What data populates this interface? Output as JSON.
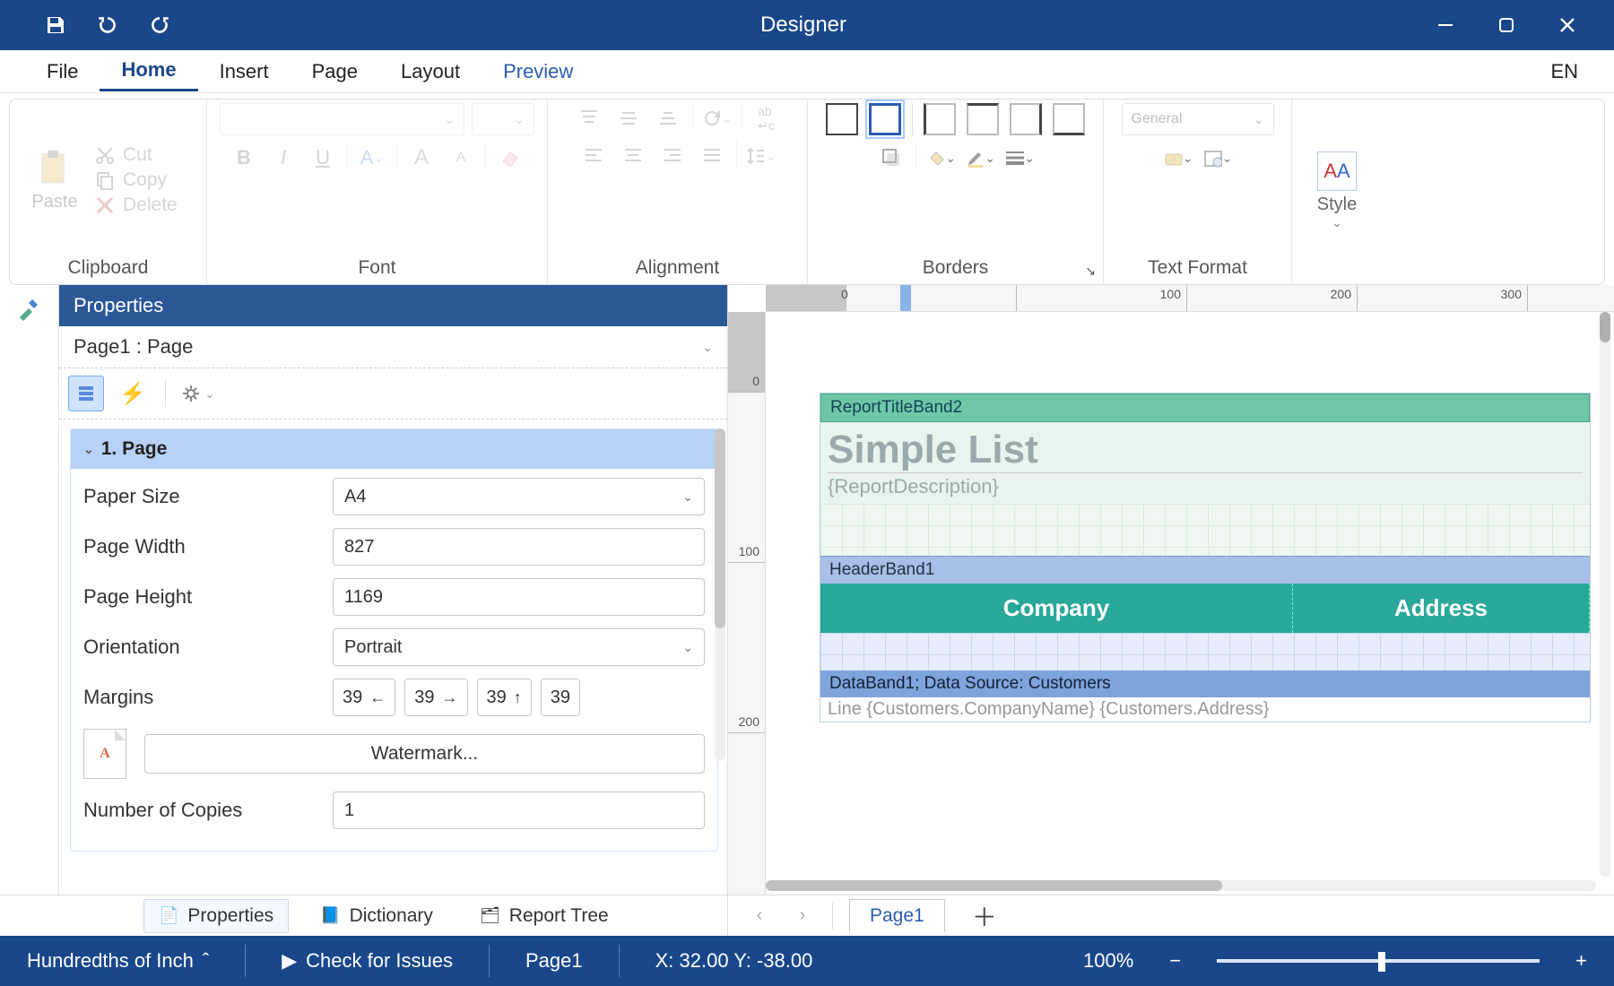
{
  "titlebar": {
    "title": "Designer"
  },
  "menu": {
    "items": [
      "File",
      "Home",
      "Insert",
      "Page",
      "Layout",
      "Preview"
    ],
    "active": "Home",
    "language": "EN"
  },
  "ribbon": {
    "clipboard": {
      "paste": "Paste",
      "cut": "Cut",
      "copy": "Copy",
      "delete": "Delete",
      "label": "Clipboard"
    },
    "font": {
      "label": "Font"
    },
    "alignment": {
      "label": "Alignment"
    },
    "borders": {
      "label": "Borders"
    },
    "textformat": {
      "general": "General",
      "label": "Text Format"
    },
    "style": {
      "label": "Style"
    }
  },
  "properties": {
    "header": "Properties",
    "selector": "Page1 : Page",
    "section_title": "1. Page",
    "rows": {
      "paper_size_label": "Paper Size",
      "paper_size_value": "A4",
      "page_width_label": "Page Width",
      "page_width_value": "827",
      "page_height_label": "Page Height",
      "page_height_value": "1169",
      "orientation_label": "Orientation",
      "orientation_value": "Portrait",
      "margins_label": "Margins",
      "margins": {
        "left": "39",
        "right": "39",
        "top": "39",
        "bottom": "39"
      },
      "watermark_button": "Watermark...",
      "copies_label": "Number of Copies",
      "copies_value": "1"
    }
  },
  "canvas": {
    "ruler_marks": [
      "0",
      "100",
      "200",
      "300"
    ],
    "vruler_marks": [
      "0",
      "100",
      "200"
    ],
    "bands": {
      "title_band": "ReportTitleBand2",
      "report_title": "Simple List",
      "report_desc": "{ReportDescription}",
      "header_band": "HeaderBand1",
      "columns": [
        "Company",
        "Address"
      ],
      "data_band": "DataBand1; Data Source: Customers",
      "data_row": "Line   {Customers.CompanyName}                                       {Customers.Address}"
    }
  },
  "bottom_tabs": {
    "left": {
      "properties": "Properties",
      "dictionary": "Dictionary",
      "report_tree": "Report Tree"
    },
    "right": {
      "page": "Page1"
    }
  },
  "statusbar": {
    "units": "Hundredths of Inch",
    "check": "Check for Issues",
    "page": "Page1",
    "coords": "X: 32.00 Y: -38.00",
    "zoom": "100%"
  }
}
